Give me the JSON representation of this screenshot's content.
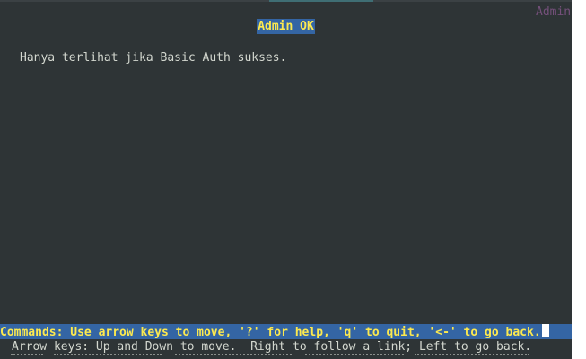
{
  "window": {
    "corner_title": "Admin"
  },
  "page": {
    "title": "Admin OK",
    "body": "Hanya terlihat jika Basic Auth sukses."
  },
  "status": {
    "commands": "Commands: Use arrow keys to move, '?' for help, 'q' to quit, '<-' to go back.",
    "help": "Arrow keys: Up and Down to move.  Right to follow a link; Left to go back."
  },
  "colors": {
    "background": "#2e3436",
    "title_bg": "#3465a4",
    "title_fg": "#fce94f",
    "text": "#d3d7cf"
  }
}
